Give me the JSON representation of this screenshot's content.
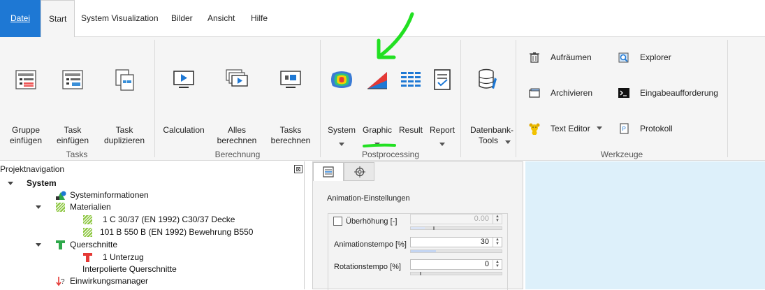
{
  "menu": {
    "file": "Datei",
    "start": "Start",
    "sysvis": "System Visualization",
    "bilder": "Bilder",
    "ansicht": "Ansicht",
    "hilfe": "Hilfe"
  },
  "ribbon": {
    "tasks": {
      "label": "Tasks",
      "gruppe": "Gruppe einfügen",
      "task": "Task einfügen",
      "duplizieren": "Task duplizieren"
    },
    "berechnung": {
      "label": "Berechnung",
      "calculation": "Calculation",
      "alles": "Alles berechnen",
      "tasks": "Tasks berechnen"
    },
    "postprocessing": {
      "label": "Postprocessing",
      "system": "System",
      "graphic": "Graphic",
      "result": "Result",
      "report": "Report"
    },
    "datenbank": {
      "label": "Datenbank-Tools"
    },
    "werkzeuge": {
      "label": "Werkzeuge",
      "aufraeumen": "Aufräumen",
      "archivieren": "Archivieren",
      "texteditor": "Text Editor",
      "explorer": "Explorer",
      "eingabe": "Eingabeaufforderung",
      "protokoll": "Protokoll"
    }
  },
  "nav": {
    "title": "Projektnavigation",
    "close": "⊠",
    "items": [
      {
        "label": "System"
      },
      {
        "label": "Systeminformationen"
      },
      {
        "label": "Materialien"
      },
      {
        "label": "1 C 30/37 (EN 1992) C30/37 Decke"
      },
      {
        "label": "101 B 550 B (EN 1992) Bewehrung B550"
      },
      {
        "label": "Querschnitte"
      },
      {
        "label": "1 Unterzug"
      },
      {
        "label": "Interpolierte Querschnitte"
      },
      {
        "label": "Einwirkungsmanager"
      }
    ]
  },
  "panel": {
    "title": "Animation-Einstellungen",
    "ueberhoehung": {
      "label": "Überhöhung [-]",
      "value": "0.00",
      "checked": false,
      "level": 0.0
    },
    "animationstempo": {
      "label": "Animationstempo [%]",
      "value": "30",
      "level": 0.3
    },
    "rotationstempo": {
      "label": "Rotationstempo [%]",
      "value": "0",
      "level": 0.0
    }
  },
  "colors": {
    "accent": "#1e78d4",
    "annotation": "#22e022",
    "background_right": "#ddf0fa"
  }
}
